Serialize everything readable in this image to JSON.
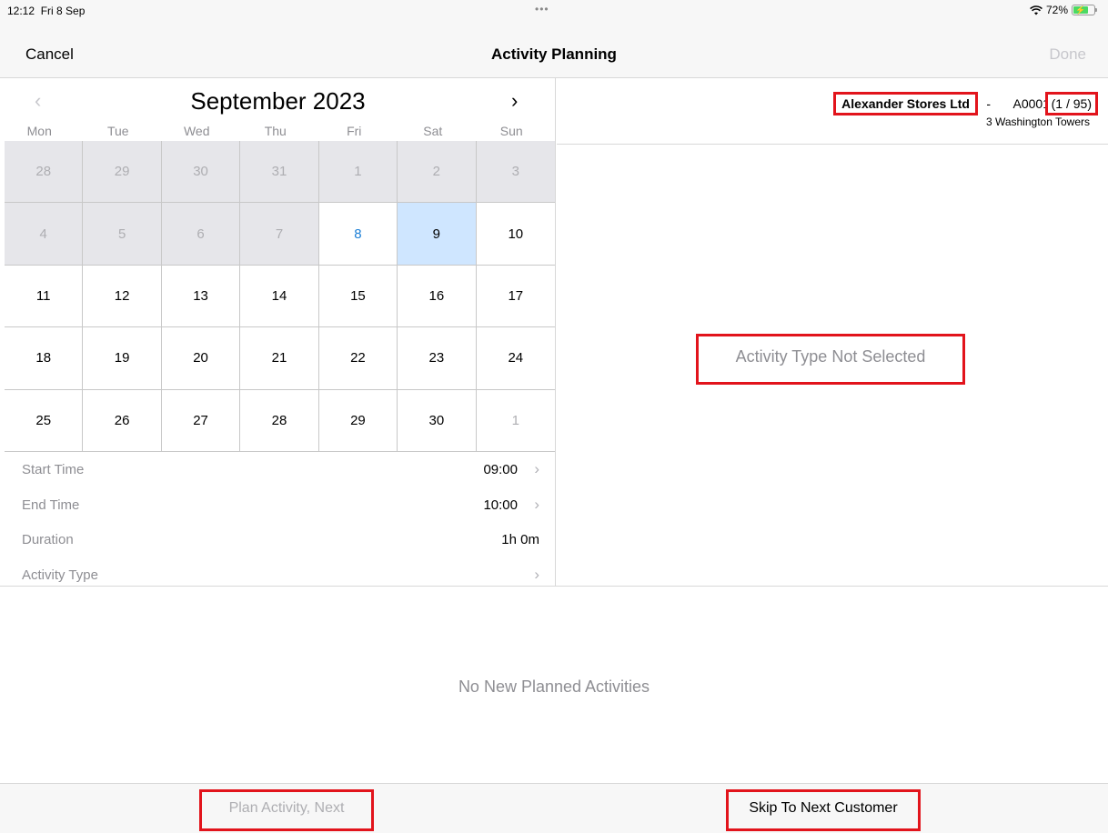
{
  "status": {
    "time": "12:12",
    "date": "Fri 8 Sep",
    "battery": "72%",
    "dots": "•••",
    "wifi_icon": "wifi-icon",
    "battery_icon": "battery-charging-icon"
  },
  "nav": {
    "cancel": "Cancel",
    "title": "Activity Planning",
    "done": "Done"
  },
  "calendar": {
    "month_label": "September 2023",
    "prev_icon": "chevron-left-icon",
    "next_icon": "chevron-right-icon",
    "weekdays": [
      "Mon",
      "Tue",
      "Wed",
      "Thu",
      "Fri",
      "Sat",
      "Sun"
    ],
    "weeks": [
      [
        "28",
        "29",
        "30",
        "31",
        "1",
        "2",
        "3"
      ],
      [
        "4",
        "5",
        "6",
        "7",
        "8",
        "9",
        "10"
      ],
      [
        "11",
        "12",
        "13",
        "14",
        "15",
        "16",
        "17"
      ],
      [
        "18",
        "19",
        "20",
        "21",
        "22",
        "23",
        "24"
      ],
      [
        "25",
        "26",
        "27",
        "28",
        "29",
        "30",
        "1"
      ]
    ],
    "today": "8",
    "selected": "9"
  },
  "details": {
    "start_time_label": "Start Time",
    "start_time": "09:00",
    "end_time_label": "End Time",
    "end_time": "10:00",
    "duration_label": "Duration",
    "duration": "1h 0m",
    "activity_type_label": "Activity Type",
    "activity_type": ""
  },
  "customer": {
    "name": "Alexander Stores Ltd",
    "separator": "-",
    "code": "A0001",
    "count": "(1 / 95)",
    "address": "3 Washington Towers"
  },
  "activity_type_message": "Activity Type Not Selected",
  "planned_empty": "No New Planned Activities",
  "footer": {
    "plan_next": "Plan Activity, Next",
    "skip": "Skip To Next Customer"
  },
  "colors": {
    "accent": "#1c7fd6",
    "selected_day": "#cfe6ff",
    "past_day": "#e6e6ea",
    "highlight_box": "#e2141c",
    "disabled_text": "#aeaeb2"
  }
}
